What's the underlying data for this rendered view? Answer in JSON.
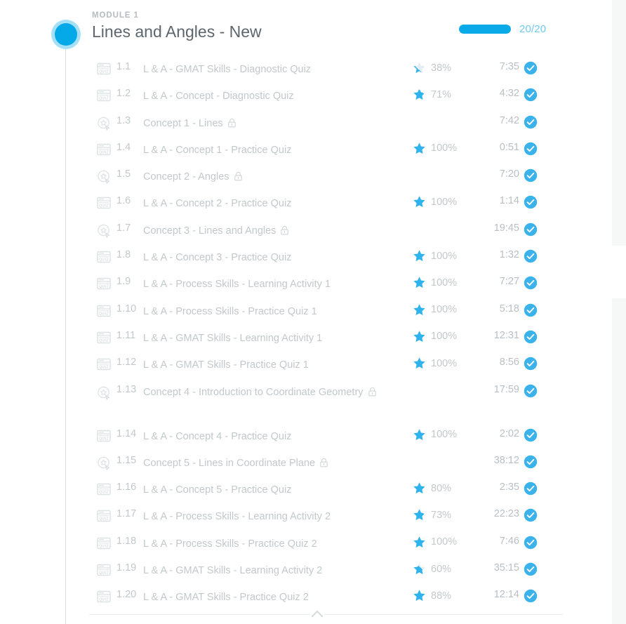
{
  "module": {
    "label": "MODULE 1",
    "title": "Lines and Angles - New",
    "node_color": "#06a9e8",
    "progress": {
      "completed": 20,
      "total": 20,
      "text": "20/20",
      "percent": 100,
      "fill_color": "#0aa9e8",
      "track_color": "#e7eaec",
      "text_color": "#6fc9ef"
    }
  },
  "colors": {
    "accent": "#06a9e8",
    "muted_text": "#c3c8cb",
    "title_text": "#5d666d",
    "label_text": "#b6bcc0",
    "star_filled": "#2fb3ec",
    "star_empty": "#e4edf3",
    "check_circle": "#3bb3ea",
    "divider": "#e8ebec",
    "panel_bg": "#f6f7f7"
  },
  "footer": {
    "collapse_icon": "chevron-up-icon"
  },
  "lessons": [
    {
      "index": "1.1",
      "title": "L & A - GMAT Skills - Diagnostic Quiz",
      "type": "quiz",
      "type_icon": "quiz-icon",
      "locked": false,
      "score": "38%",
      "score_value": 38,
      "time": "7:35",
      "status": "complete",
      "status_icon": "check-circle-icon"
    },
    {
      "index": "1.2",
      "title": "L & A - Concept - Diagnostic Quiz",
      "type": "quiz",
      "type_icon": "quiz-icon",
      "locked": false,
      "score": "71%",
      "score_value": 71,
      "time": "4:32",
      "status": "complete",
      "status_icon": "check-circle-icon"
    },
    {
      "index": "1.3",
      "title": "Concept 1 - Lines",
      "type": "lesson",
      "type_icon": "lesson-icon",
      "locked": true,
      "score": "",
      "score_value": null,
      "time": "7:42",
      "status": "complete",
      "status_icon": "check-circle-icon"
    },
    {
      "index": "1.4",
      "title": "L & A - Concept 1 - Practice Quiz",
      "type": "quiz",
      "type_icon": "quiz-icon",
      "locked": false,
      "score": "100%",
      "score_value": 100,
      "time": "0:51",
      "status": "complete",
      "status_icon": "check-circle-icon"
    },
    {
      "index": "1.5",
      "title": "Concept 2 - Angles",
      "type": "lesson",
      "type_icon": "lesson-icon",
      "locked": true,
      "score": "",
      "score_value": null,
      "time": "7:20",
      "status": "complete",
      "status_icon": "check-circle-icon"
    },
    {
      "index": "1.6",
      "title": "L & A - Concept 2 - Practice Quiz",
      "type": "quiz",
      "type_icon": "quiz-icon",
      "locked": false,
      "score": "100%",
      "score_value": 100,
      "time": "1:14",
      "status": "complete",
      "status_icon": "check-circle-icon"
    },
    {
      "index": "1.7",
      "title": "Concept 3 - Lines and Angles",
      "type": "lesson",
      "type_icon": "lesson-icon",
      "locked": true,
      "score": "",
      "score_value": null,
      "time": "19:45",
      "status": "complete",
      "status_icon": "check-circle-icon"
    },
    {
      "index": "1.8",
      "title": "L & A - Concept 3 - Practice Quiz",
      "type": "quiz",
      "type_icon": "quiz-icon",
      "locked": false,
      "score": "100%",
      "score_value": 100,
      "time": "1:32",
      "status": "complete",
      "status_icon": "check-circle-icon"
    },
    {
      "index": "1.9",
      "title": "L & A - Process Skills - Learning Activity 1",
      "type": "quiz",
      "type_icon": "quiz-icon",
      "locked": false,
      "score": "100%",
      "score_value": 100,
      "time": "7:27",
      "status": "complete",
      "status_icon": "check-circle-icon"
    },
    {
      "index": "1.10",
      "title": "L & A - Process Skills - Practice Quiz 1",
      "type": "quiz",
      "type_icon": "quiz-icon",
      "locked": false,
      "score": "100%",
      "score_value": 100,
      "time": "5:18",
      "status": "complete",
      "status_icon": "check-circle-icon"
    },
    {
      "index": "1.11",
      "title": "L & A - GMAT Skills - Learning Activity 1",
      "type": "quiz",
      "type_icon": "quiz-icon",
      "locked": false,
      "score": "100%",
      "score_value": 100,
      "time": "12:31",
      "status": "complete",
      "status_icon": "check-circle-icon"
    },
    {
      "index": "1.12",
      "title": "L & A - GMAT Skills - Practice Quiz 1",
      "type": "quiz",
      "type_icon": "quiz-icon",
      "locked": false,
      "score": "100%",
      "score_value": 100,
      "time": "8:56",
      "status": "complete",
      "status_icon": "check-circle-icon"
    },
    {
      "index": "1.13",
      "title": "Concept 4 - Introduction to Coordinate Geometry",
      "type": "lesson",
      "type_icon": "lesson-icon",
      "locked": true,
      "score": "",
      "score_value": null,
      "time": "17:59",
      "status": "complete",
      "status_icon": "check-circle-icon",
      "wraps": true
    },
    {
      "index": "1.14",
      "title": "L & A - Concept 4 - Practice Quiz",
      "type": "quiz",
      "type_icon": "quiz-icon",
      "locked": false,
      "score": "100%",
      "score_value": 100,
      "time": "2:02",
      "status": "complete",
      "status_icon": "check-circle-icon"
    },
    {
      "index": "1.15",
      "title": "Concept 5 - Lines in Coordinate Plane",
      "type": "lesson",
      "type_icon": "lesson-icon",
      "locked": true,
      "score": "",
      "score_value": null,
      "time": "38:12",
      "status": "complete",
      "status_icon": "check-circle-icon"
    },
    {
      "index": "1.16",
      "title": "L & A - Concept 5 - Practice Quiz",
      "type": "quiz",
      "type_icon": "quiz-icon",
      "locked": false,
      "score": "80%",
      "score_value": 80,
      "time": "2:35",
      "status": "complete",
      "status_icon": "check-circle-icon"
    },
    {
      "index": "1.17",
      "title": "L & A - Process Skills - Learning Activity 2",
      "type": "quiz",
      "type_icon": "quiz-icon",
      "locked": false,
      "score": "73%",
      "score_value": 73,
      "time": "22:23",
      "status": "complete",
      "status_icon": "check-circle-icon"
    },
    {
      "index": "1.18",
      "title": "L & A - Process Skills - Practice Quiz 2",
      "type": "quiz",
      "type_icon": "quiz-icon",
      "locked": false,
      "score": "100%",
      "score_value": 100,
      "time": "7:46",
      "status": "complete",
      "status_icon": "check-circle-icon"
    },
    {
      "index": "1.19",
      "title": "L & A - GMAT Skills - Learning Activity 2",
      "type": "quiz",
      "type_icon": "quiz-icon",
      "locked": false,
      "score": "60%",
      "score_value": 60,
      "time": "35:15",
      "status": "complete",
      "status_icon": "check-circle-icon"
    },
    {
      "index": "1.20",
      "title": "L & A - GMAT Skills - Practice Quiz 2",
      "type": "quiz",
      "type_icon": "quiz-icon",
      "locked": false,
      "score": "88%",
      "score_value": 88,
      "time": "12:14",
      "status": "complete",
      "status_icon": "check-circle-icon"
    }
  ]
}
